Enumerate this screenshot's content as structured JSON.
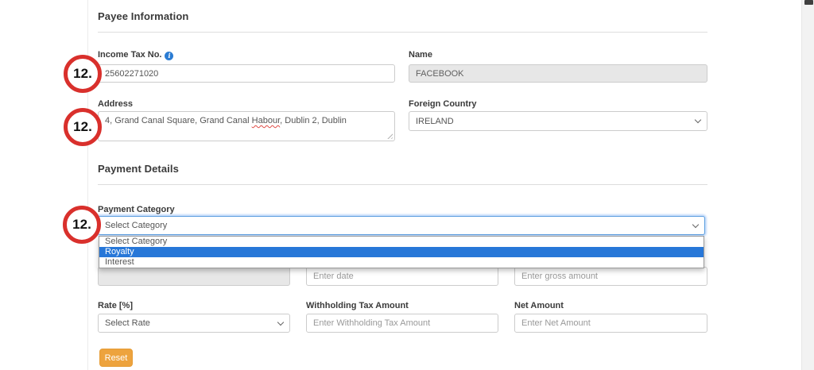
{
  "colors": {
    "annotation_red": "#d9302c",
    "selection_blue": "#2777d8",
    "info_blue": "#2b7cd3",
    "reset_orange": "#eda33e",
    "focus_ring_blue": "#5b9ee0"
  },
  "payee": {
    "title": "Payee Information",
    "income_tax": {
      "label": "Income Tax No.",
      "value": "25602271020"
    },
    "name": {
      "label": "Name",
      "value": "FACEBOOK"
    },
    "address": {
      "label": "Address",
      "text_before": "4, Grand Canal Square, Grand Canal ",
      "misspelled_word": "Habour",
      "text_after": ", Dublin 2, Dublin"
    },
    "foreign_country": {
      "label": "Foreign Country",
      "value": "IRELAND"
    }
  },
  "payment": {
    "title": "Payment Details",
    "category": {
      "label": "Payment Category",
      "value": "Select Category",
      "options": [
        "Select Category",
        "Royalty",
        "Interest"
      ],
      "highlighted_option": "Royalty"
    },
    "date": {
      "placeholder": "Enter date"
    },
    "gross_amount": {
      "placeholder": "Enter gross amount"
    },
    "rate": {
      "label": "Rate [%]",
      "value": "Select Rate"
    },
    "withholding_tax": {
      "label": "Withholding Tax Amount",
      "placeholder": "Enter Withholding Tax Amount"
    },
    "net_amount": {
      "label": "Net Amount",
      "placeholder": "Enter Net Amount"
    },
    "reset_label": "Reset"
  },
  "annotations": {
    "step_label": "12."
  }
}
